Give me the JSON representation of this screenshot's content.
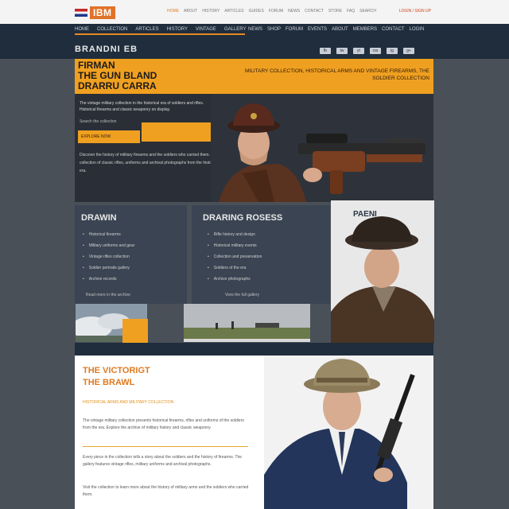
{
  "header": {
    "logo_text": "IBM",
    "util_links": [
      "HOME",
      "ABOUT",
      "HISTORY",
      "ARTICLES",
      "GUIDES",
      "FORUM",
      "NEWS",
      "CONTACT",
      "STORE",
      "FAQ",
      "SEARCH"
    ],
    "util_right": "LOGIN / SIGN UP"
  },
  "nav": {
    "left_items": [
      "HOME",
      "COLLECTION",
      "ARTICLES",
      "HISTORY",
      "VINTAGE",
      "GALLERY"
    ],
    "right_items": [
      "NEWS",
      "SHOP",
      "FORUM",
      "EVENTS",
      "ABOUT",
      "MEMBERS",
      "CONTACT",
      "LOGIN"
    ],
    "brand_sub": "BRANDNI EB",
    "icons": [
      "fb",
      "tw",
      "yt",
      "rss",
      "ig",
      "g+"
    ]
  },
  "hero": {
    "title": "FIRMAN\nTHE GUN BLAND\nDRARRU CARRA",
    "tagline": "MILITARY COLLECTION, HISTORICAL ARMS AND VINTAGE FIREARMS, THE SOLDIER COLLECTION",
    "body": "The vintage military collection in the historical era of soldiers and rifles. Historical firearms and classic weaponry on display.",
    "label": "Search the collection",
    "input_placeholder": "",
    "button_label": "EXPLORE NOW",
    "body2": "Discover the history of military firearms and the soldiers who carried them. A collection of classic rifles, uniforms and archival photographs from the historical era."
  },
  "col1": {
    "title": "DRAWIN",
    "items": [
      "Historical firearms",
      "Military uniforms and gear",
      "Vintage rifles collection",
      "Soldier portraits gallery",
      "Archive records"
    ],
    "foot": "Read more in the archive"
  },
  "col2": {
    "title": "DRARING ROSESS",
    "items": [
      "Rifle history and design",
      "Historical military events",
      "Collection and preservation",
      "Soldiers of the era",
      "Archive photographs"
    ],
    "foot": "View the full gallery"
  },
  "portrait1": {
    "label": "PAENI"
  },
  "lower": {
    "title": "THE VICTORIGT\nTHE BRAWL",
    "subtitle": "HISTORICAL ARMS AND MILITARY COLLECTION",
    "para1": "The vintage military collection presents historical firearms, rifles and uniforms of the soldiers from the era. Explore the archive of military history and classic weaponry.",
    "para2": "Every piece in the collection tells a story about the soldiers and the history of firearms. The gallery features vintage rifles, military uniforms and archival photographs.",
    "para3": "Visit the collection to learn more about the history of military arms and the soldiers who carried them."
  },
  "colors": {
    "accent": "#f0a020",
    "navy": "#1f2d3d",
    "panel": "#3a4452",
    "background": "#4a5058"
  }
}
